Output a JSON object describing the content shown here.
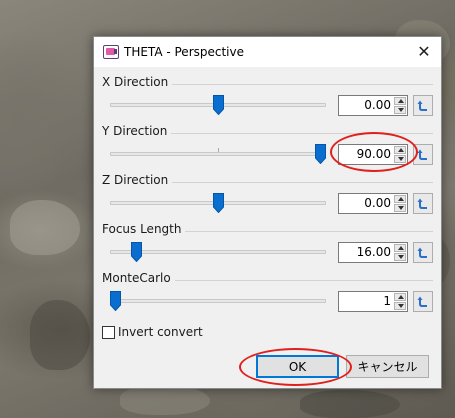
{
  "window": {
    "title": "THETA - Perspective",
    "close_glyph": "✕"
  },
  "params": [
    {
      "label": "X Direction",
      "value": "0.00",
      "slider_fraction": 0.5
    },
    {
      "label": "Y Direction",
      "value": "90.00",
      "slider_fraction": 1.0
    },
    {
      "label": "Z Direction",
      "value": "0.00",
      "slider_fraction": 0.5
    },
    {
      "label": "Focus Length",
      "value": "16.00",
      "slider_fraction": 0.1
    },
    {
      "label": "MonteCarlo",
      "value": "1",
      "slider_fraction": 0.0
    }
  ],
  "invert": {
    "label": "Invert convert",
    "checked": false
  },
  "buttons": {
    "ok": "OK",
    "cancel": "キャンセル"
  },
  "icons": {
    "app": "theta-app-icon",
    "close": "close-icon",
    "reset": "reset-arrow-icon",
    "spin_up": "spin-up-icon",
    "spin_down": "spin-down-icon"
  },
  "colors": {
    "thumb": "#0a6dd0",
    "highlight": "#e0201c",
    "ok_border": "#0078d7"
  }
}
